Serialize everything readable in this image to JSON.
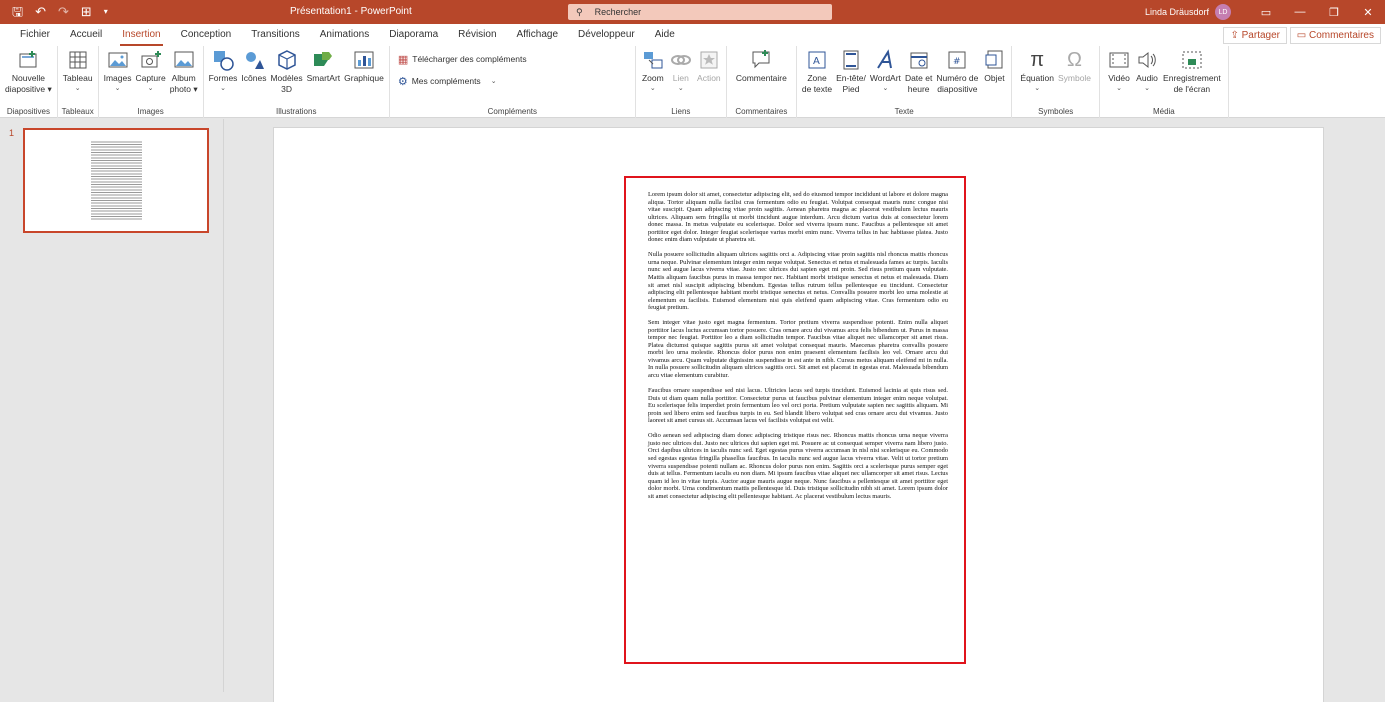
{
  "titlebar": {
    "title": "Présentation1 - PowerPoint",
    "search_placeholder": "Rechercher",
    "user_name": "Linda Dräusdorf",
    "user_initials": "LD"
  },
  "menubar": {
    "tabs": [
      "Fichier",
      "Accueil",
      "Insertion",
      "Conception",
      "Transitions",
      "Animations",
      "Diaporama",
      "Révision",
      "Affichage",
      "Développeur",
      "Aide"
    ],
    "active_tab": "Insertion",
    "share_label": "Partager",
    "comments_label": "Commentaires"
  },
  "ribbon": {
    "groups": {
      "diapositives": "Diapositives",
      "tableaux": "Tableaux",
      "images": "Images",
      "illustrations": "Illustrations",
      "complements": "Compléments",
      "liens": "Liens",
      "commentaires": "Commentaires",
      "texte": "Texte",
      "symboles": "Symboles",
      "media": "Média"
    },
    "buttons": {
      "nouvelle": [
        "Nouvelle",
        "diapositive ▾"
      ],
      "tableau": "Tableau",
      "images": "Images",
      "capture": "Capture",
      "album": [
        "Album",
        "photo ▾"
      ],
      "formes": "Formes",
      "icones": "Icônes",
      "modeles3d": [
        "Modèles",
        "3D"
      ],
      "smartart": "SmartArt",
      "graphique": "Graphique",
      "telecharger": "Télécharger des compléments",
      "mescomplements": "Mes compléments",
      "zoom": "Zoom",
      "lien": "Lien",
      "action": "Action",
      "commentaire": "Commentaire",
      "zonetexte": [
        "Zone",
        "de texte"
      ],
      "entete": [
        "En-tête/",
        "Pied"
      ],
      "wordart": "WordArt",
      "dateheure": [
        "Date et",
        "heure"
      ],
      "numero": [
        "Numéro de",
        "diapositive"
      ],
      "objet": "Objet",
      "equation": "Équation",
      "symbole": "Symbole",
      "video": "Vidéo",
      "audio": "Audio",
      "enregistrement": [
        "Enregistrement",
        "de l'écran"
      ]
    }
  },
  "slides": {
    "number": "1"
  },
  "textbox": {
    "paragraphs": [
      "Lorem ipsum dolor sit amet, consectetur adipiscing elit, sed do eiusmod tempor incididunt ut labore et dolore magna aliqua. Tortor aliquam nulla facilisi cras fermentum odio eu feugiat. Volutpat consequat mauris nunc congue nisi vitae suscipit. Quam adipiscing vitae proin sagittis. Aenean pharetra magna ac placerat vestibulum lectus mauris ultrices. Aliquam sem fringilla ut morbi tincidunt augue interdum. Arcu dictum varius duis at consectetur lorem donec massa. In metus vulputate eu scelerisque. Dolor sed viverra ipsum nunc. Faucibus a pellentesque sit amet porttitor eget dolor. Integer feugiat scelerisque varius morbi enim nunc. Viverra tellus in hac habitasse platea. Justo donec enim diam vulputate ut pharetra sit.",
      "Nulla posuere sollicitudin aliquam ultrices sagittis orci a. Adipiscing vitae proin sagittis nisl rhoncus mattis rhoncus urna neque. Pulvinar elementum integer enim neque volutpat. Senectus et netus et malesuada fames ac turpis. Iaculis nunc sed augue lacus viverra vitae. Justo nec ultrices dui sapien eget mi proin. Sed risus pretium quam vulputate. Mattis aliquam faucibus purus in massa tempor nec. Habitant morbi tristique senectus et netus et malesuada. Diam sit amet nisl suscipit adipiscing bibendum. Egestas tellus rutrum tellus pellentesque eu tincidunt. Consectetur adipiscing elit pellentesque habitant morbi tristique senectus et netus. Convallis posuere morbi leo urna molestie at elementum eu facilisis. Euismod elementum nisi quis eleifend quam adipiscing vitae. Cras fermentum odio eu feugiat pretium.",
      "Sem integer vitae justo eget magna fermentum. Tortor pretium viverra suspendisse potenti. Enim nulla aliquet porttitor lacus luctus accumsan tortor posuere. Cras ornare arcu dui vivamus arcu felis bibendum ut. Purus in massa tempor nec feugiat. Porttitor leo a diam sollicitudin tempor. Faucibus vitae aliquet nec ullamcorper sit amet risus. Platea dictumst quisque sagittis purus sit amet volutpat consequat mauris. Maecenas pharetra convallis posuere morbi leo urna molestie. Rhoncus dolor purus non enim praesent elementum facilisis leo vel. Ornare arcu dui vivamus arcu. Quam vulputate dignissim suspendisse in est ante in nibh. Cursus metus aliquam eleifend mi in nulla. In nulla posuere sollicitudin aliquam ultrices sagittis orci. Sit amet est placerat in egestas erat. Malesuada bibendum arcu vitae elementum curabitur.",
      "Faucibus ornare suspendisse sed nisi lacus. Ultricies lacus sed turpis tincidunt. Euismod lacinia at quis risus sed. Duis ut diam quam nulla porttitor. Consectetur purus ut faucibus pulvinar elementum integer enim neque volutpat. Eu scelerisque felis imperdiet proin fermentum leo vel orci porta. Pretium vulputate sapien nec sagittis aliquam. Mi proin sed libero enim sed faucibus turpis in eu. Sed blandit libero volutpat sed cras ornare arcu dui vivamus. Justo laoreet sit amet cursus sit. Accumsan lacus vel facilisis volutpat est velit.",
      "Odio aenean sed adipiscing diam donec adipiscing tristique risus nec. Rhoncus mattis rhoncus urna neque viverra justo nec ultrices dui. Justo nec ultrices dui sapien eget mi. Posuere ac ut consequat semper viverra nam libero justo. Orci dapibus ultrices in iaculis nunc sed. Eget egestas purus viverra accumsan in nisl nisi scelerisque eu. Commodo sed egestas egestas fringilla phasellus faucibus. In iaculis nunc sed augue lacus viverra vitae. Velit ut tortor pretium viverra suspendisse potenti nullam ac. Rhoncus dolor purus non enim. Sagittis orci a scelerisque purus semper eget duis at tellus. Fermentum iaculis eu non diam. Mi ipsum faucibus vitae aliquet nec ullamcorper sit amet risus. Lectus quam id leo in vitae turpis. Auctor augue mauris augue neque. Nunc faucibus a pellentesque sit amet porttitor eget dolor morbi. Urna condimentum mattis pellentesque id. Duis tristique sollicitudin nibh sit amet. Lorem ipsum dolor sit amet consectetur adipiscing elit pellentesque habitant. Ac placerat vestibulum lectus mauris."
    ]
  },
  "colors": {
    "accent": "#b7472a",
    "textbox_border": "#e0141c"
  }
}
